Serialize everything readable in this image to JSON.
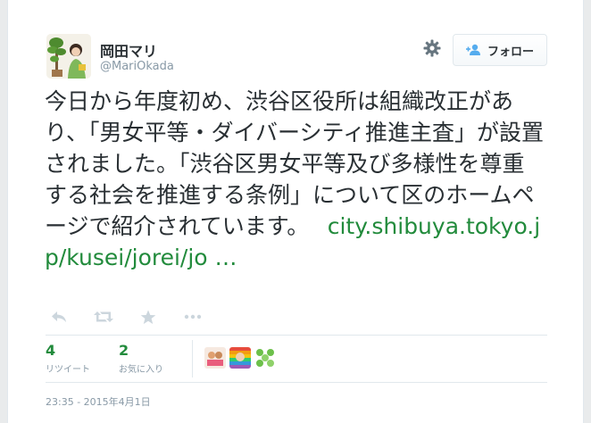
{
  "user": {
    "name": "岡田マリ",
    "handle": "@MariOkada"
  },
  "header": {
    "follow_label": "フォロー"
  },
  "tweet": {
    "text": "今日から年度初め、渋谷区役所は組織改正があり、「男女平等・ダイバーシティ推進主査」が設置されました。「渋谷区男女平等及び多様性を尊重する社会を推進する条例」について区のホームページで紹介されています。　 ",
    "link": "city.shibuya.tokyo.jp/kusei/jorei/jo …"
  },
  "stats": {
    "retweets_count": "4",
    "retweets_label": "リツイート",
    "favorites_count": "2",
    "favorites_label": "お気に入り"
  },
  "timestamp": "23:35 - 2015年4月1日",
  "colors": {
    "link": "#228b3c",
    "count": "#228b3c",
    "muted": "#8899a6",
    "text": "#292f33"
  },
  "icons": [
    "gear-icon",
    "follow-person-icon",
    "reply-icon",
    "retweet-icon",
    "favorite-star-icon",
    "more-dots-icon"
  ]
}
